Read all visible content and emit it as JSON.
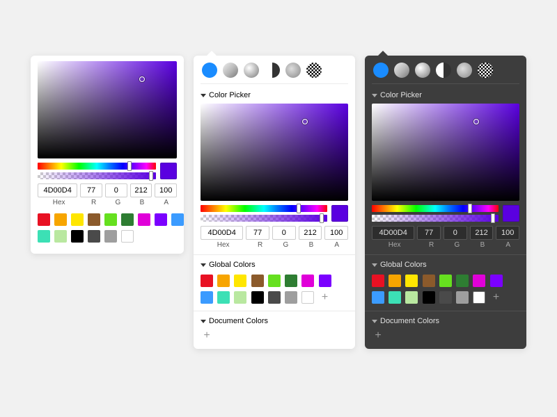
{
  "sections": {
    "picker": "Color Picker",
    "global": "Global Colors",
    "document": "Document Colors"
  },
  "fill_tabs": [
    "solid",
    "linear-gradient",
    "radial-gradient",
    "angular-gradient",
    "image",
    "noise"
  ],
  "inputs": {
    "hex": "4D00D4",
    "r": "77",
    "g": "0",
    "b": "212",
    "a": "100"
  },
  "labels": {
    "hex": "Hex",
    "r": "R",
    "g": "G",
    "b": "B",
    "a": "A"
  },
  "current_color": "#5a00e0",
  "swatches_row1": [
    "#e81123",
    "#f7a500",
    "#ffe600",
    "#8b5a2b",
    "#66e01f",
    "#2e7d32",
    "#e000d9",
    "#7b00ff"
  ],
  "swatches_row2": [
    "#3b9bff",
    "#3ce0b5",
    "#b9e8a0",
    "#000000",
    "#4a4a4a",
    "#9e9e9e",
    "#ffffff"
  ],
  "add_label": "+"
}
